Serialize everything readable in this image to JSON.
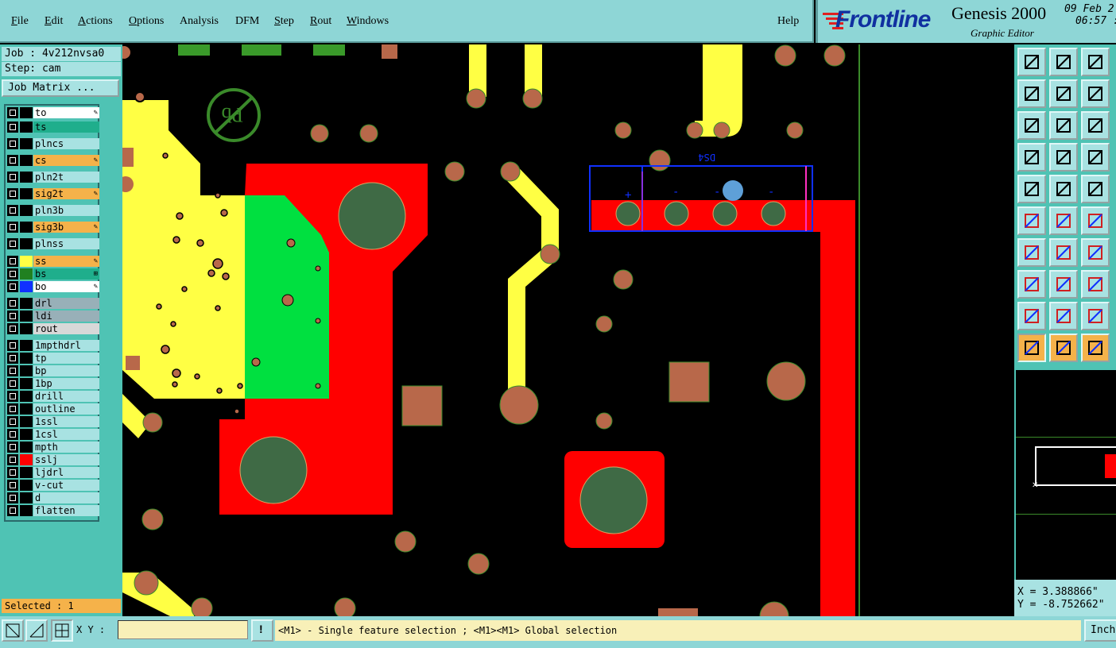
{
  "menubar": {
    "items": [
      {
        "label": "File",
        "u": "F",
        "rest": "ile"
      },
      {
        "label": "Edit",
        "u": "E",
        "rest": "dit"
      },
      {
        "label": "Actions",
        "u": "A",
        "rest": "ctions"
      },
      {
        "label": "Options",
        "u": "O",
        "rest": "ptions"
      },
      {
        "label": "Analysis",
        "u": "",
        "rest": "Analysis"
      },
      {
        "label": "DFM",
        "u": "",
        "rest": "DFM"
      },
      {
        "label": "Step",
        "u": "S",
        "rest": "tep"
      },
      {
        "label": "Rout",
        "u": "R",
        "rest": "out"
      },
      {
        "label": "Windows",
        "u": "W",
        "rest": "indows"
      }
    ],
    "help": "Help"
  },
  "branding": {
    "logo": "Frontline",
    "product": "Genesis 2000",
    "subtitle": "Graphic Editor",
    "date": "09 Feb 2",
    "time": "06:57 :"
  },
  "job": {
    "job_line": "Job : 4v212nvsa0",
    "step_line": "Step: cam",
    "matrix_button": "Job Matrix ..."
  },
  "layers": [
    {
      "name": "to",
      "bg": "#ffffff",
      "sw": "#000000",
      "flag": "✎"
    },
    {
      "name": "ts",
      "bg": "#1fae8c",
      "sw": "#000000",
      "flag": ""
    },
    {
      "name": "plncs",
      "bg": "#a8e2e2",
      "sw": "#000000",
      "flag": ""
    },
    {
      "name": "cs",
      "bg": "#f5b24a",
      "sw": "#000000",
      "flag": "✎"
    },
    {
      "name": "pln2t",
      "bg": "#a8e2e2",
      "sw": "#000000",
      "flag": ""
    },
    {
      "name": "sig2t",
      "bg": "#f5b24a",
      "sw": "#000000",
      "flag": "✎"
    },
    {
      "name": "pln3b",
      "bg": "#a8e2e2",
      "sw": "#000000",
      "flag": ""
    },
    {
      "name": "sig3b",
      "bg": "#f5b24a",
      "sw": "#000000",
      "flag": "✎"
    },
    {
      "name": "plnss",
      "bg": "#a8e2e2",
      "sw": "#000000",
      "flag": ""
    },
    {
      "name": "ss",
      "bg": "#f5b24a",
      "sw": "#ffff44",
      "flag": "✎"
    },
    {
      "name": "bs",
      "bg": "#1fae8c",
      "sw": "#208020",
      "flag": "⊞"
    },
    {
      "name": "bo",
      "bg": "#ffffff",
      "sw": "#1030ff",
      "flag": "✎"
    },
    {
      "name": "drl",
      "bg": "#98b0b8",
      "sw": "#000000",
      "flag": ""
    },
    {
      "name": "ldi",
      "bg": "#98b0b8",
      "sw": "#000000",
      "flag": ""
    },
    {
      "name": "rout",
      "bg": "#d8d8d8",
      "sw": "#000000",
      "flag": ""
    },
    {
      "name": "1mpthdrl",
      "bg": "#a8e2e2",
      "sw": "#000000",
      "flag": ""
    },
    {
      "name": "tp",
      "bg": "#a8e2e2",
      "sw": "#000000",
      "flag": ""
    },
    {
      "name": "bp",
      "bg": "#a8e2e2",
      "sw": "#000000",
      "flag": ""
    },
    {
      "name": "1bp",
      "bg": "#a8e2e2",
      "sw": "#000000",
      "flag": ""
    },
    {
      "name": "drill",
      "bg": "#a8e2e2",
      "sw": "#000000",
      "flag": ""
    },
    {
      "name": "outline",
      "bg": "#a8e2e2",
      "sw": "#000000",
      "flag": ""
    },
    {
      "name": "1ssl",
      "bg": "#a8e2e2",
      "sw": "#000000",
      "flag": ""
    },
    {
      "name": "1csl",
      "bg": "#a8e2e2",
      "sw": "#000000",
      "flag": ""
    },
    {
      "name": "mpth",
      "bg": "#a8e2e2",
      "sw": "#000000",
      "flag": ""
    },
    {
      "name": "sslj",
      "bg": "#a8e2e2",
      "sw": "#ff0000",
      "flag": ""
    },
    {
      "name": "ljdrl",
      "bg": "#a8e2e2",
      "sw": "#000000",
      "flag": ""
    },
    {
      "name": "v-cut",
      "bg": "#a8e2e2",
      "sw": "#000000",
      "flag": ""
    },
    {
      "name": "d",
      "bg": "#a8e2e2",
      "sw": "#000000",
      "flag": ""
    },
    {
      "name": "flatten",
      "bg": "#a8e2e2",
      "sw": "#000000",
      "flag": ""
    }
  ],
  "status": {
    "selected": "Selected : 1",
    "x": "X = 3.388866\"",
    "y": "Y = -8.752662\"",
    "xy_label": "X Y :",
    "hint": "<M1> - Single feature selection ; <M1><M1> Global selection",
    "units": "Inch"
  },
  "canvas": {
    "component_label": "DS4",
    "pin_marks": [
      "+",
      "-",
      "-",
      "-"
    ]
  },
  "colors": {
    "menu_bg": "#8ed6d6",
    "panel_bg": "#4fc3b4",
    "copper_red": "#ff0000",
    "silk_yellow": "#ffff44",
    "solder_green": "#00e040",
    "pad_brown": "#b8684a",
    "hole_green": "#3f6a45"
  }
}
